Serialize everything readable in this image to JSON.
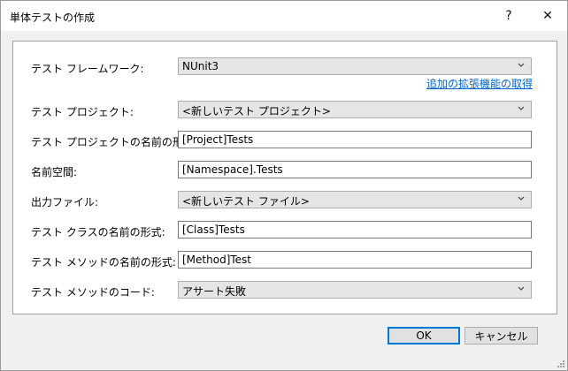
{
  "window": {
    "title": "単体テストの作成",
    "help_glyph": "?",
    "close_glyph": "✕"
  },
  "form": {
    "framework_label": "テスト フレームワーク:",
    "framework_value": "NUnit3",
    "extensions_link": "追加の拡張機能の取得",
    "project_label": "テスト プロジェクト:",
    "project_value": "<新しいテスト プロジェクト>",
    "project_name_format_label": "テスト プロジェクトの名前の形式:",
    "project_name_format_value": "[Project]Tests",
    "namespace_label": "名前空間:",
    "namespace_value": "[Namespace].Tests",
    "output_file_label": "出力ファイル:",
    "output_file_value": "<新しいテスト ファイル>",
    "class_name_format_label": "テスト クラスの名前の形式:",
    "class_name_format_value": "[Class]Tests",
    "method_name_format_label": "テスト メソッドの名前の形式:",
    "method_name_format_value": "[Method]Test",
    "method_code_label": "テスト メソッドのコード:",
    "method_code_value": "アサート失敗"
  },
  "buttons": {
    "ok": "OK",
    "cancel": "キャンセル"
  }
}
